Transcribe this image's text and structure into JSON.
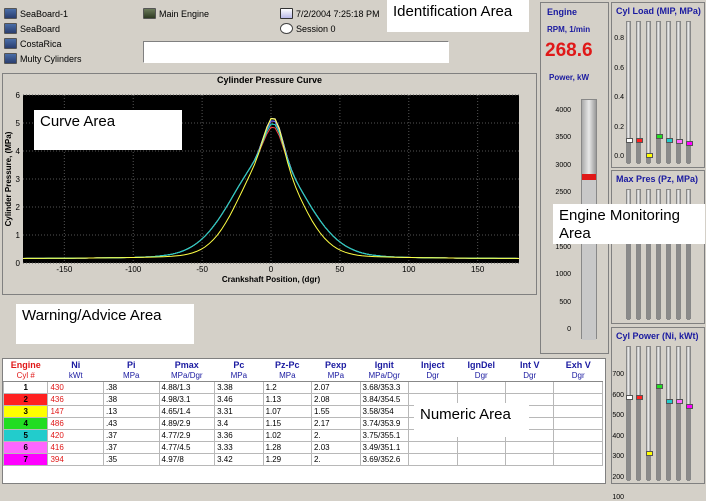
{
  "identification": {
    "left_items": [
      "SeaBoard-1",
      "SeaBoard",
      "CostaRica",
      "Multy Cylinders"
    ],
    "engine_label": "Main Engine",
    "datetime": "7/2/2004 7:25:18 PM",
    "session": "Session 0",
    "area_label": "Identification Area"
  },
  "curve": {
    "title": "Cylinder Pressure Curve",
    "area_label": "Curve Area",
    "chart_data": {
      "type": "line",
      "title": "Cylinder Pressure Curve",
      "xlabel": "Crankshaft Position, (dgr)",
      "ylabel": "Cylinder Pressure, (MPa)",
      "xlim": [
        -180,
        180
      ],
      "ylim": [
        0,
        6
      ],
      "x_ticks": [
        "-150",
        "-100",
        "-50",
        "0",
        "50",
        "100",
        "150"
      ],
      "y_ticks": [
        "0",
        "1",
        "2",
        "3",
        "4",
        "5",
        "6"
      ],
      "grid": true,
      "series_colors": [
        "#ff66ff",
        "#ffffff",
        "#ff4444",
        "#4466ff",
        "#44dd44",
        "#22cccc",
        "#ffff44"
      ]
    }
  },
  "warning": {
    "area_label": "Warning/Advice Area"
  },
  "engine": {
    "title": "Engine",
    "rpm_label": "RPM, 1/min",
    "rpm_value": "268.6",
    "power_label": "Power, kW",
    "scale": [
      "4000",
      "3500",
      "3000",
      "2500",
      "2000",
      "1500",
      "1000",
      "500",
      "0"
    ],
    "power_fraction": 0.68
  },
  "monitoring": {
    "area_label": "Engine Monitoring Area"
  },
  "cyl_load": {
    "title": "Cyl Load (MIP, MPa)",
    "ticks": [
      "0.8",
      "0.6",
      "0.4",
      "0.2",
      "0.0"
    ],
    "marker_colors": [
      "#ffffff",
      "#ff2020",
      "#ffff00",
      "#22dd22",
      "#22cccc",
      "#ff66ff",
      "#ff00ff"
    ]
  },
  "max_pres": {
    "title": "Max Pres (Pz, MPa)"
  },
  "cyl_power": {
    "title": "Cyl Power (Ni, kWt)",
    "ticks": [
      "700",
      "600",
      "500",
      "400",
      "300",
      "200",
      "100"
    ]
  },
  "numeric": {
    "area_label": "Numeric Area",
    "headers": [
      "Engine",
      "Ni",
      "Pi",
      "Pmax",
      "Pc",
      "Pz-Pc",
      "Pexp",
      "Ignit",
      "Inject",
      "IgnDel",
      "Int V",
      "Exh V"
    ],
    "units": [
      "Cyl #",
      "kWt",
      "MPa",
      "MPa/Dgr",
      "MPa",
      "MPa",
      "MPa",
      "MPa/Dgr",
      "Dgr",
      "Dgr",
      "Dgr",
      "Dgr"
    ],
    "rows": [
      {
        "cyl": "1",
        "color": "#ffffff",
        "ni": "430",
        "pi": ".38",
        "pmax": "4.88/1.3",
        "pc": "3.38",
        "pzpc": "1.2",
        "pexp": "2.07",
        "ignit": "3.68/353.3"
      },
      {
        "cyl": "2",
        "color": "#ff2020",
        "ni": "436",
        "pi": ".38",
        "pmax": "4.98/3.1",
        "pc": "3.46",
        "pzpc": "1.13",
        "pexp": "2.08",
        "ignit": "3.84/354.5"
      },
      {
        "cyl": "3",
        "color": "#ffff00",
        "ni": "147",
        "pi": ".13",
        "pmax": "4.65/1.4",
        "pc": "3.31",
        "pzpc": "1.07",
        "pexp": "1.55",
        "ignit": "3.58/354"
      },
      {
        "cyl": "4",
        "color": "#22dd22",
        "ni": "486",
        "pi": ".43",
        "pmax": "4.89/2.9",
        "pc": "3.4",
        "pzpc": "1.15",
        "pexp": "2.17",
        "ignit": "3.74/353.9"
      },
      {
        "cyl": "5",
        "color": "#22cccc",
        "ni": "420",
        "pi": ".37",
        "pmax": "4.77/2.9",
        "pc": "3.36",
        "pzpc": "1.02",
        "pexp": "2.",
        "ignit": "3.75/355.1"
      },
      {
        "cyl": "6",
        "color": "#ff66ff",
        "ni": "416",
        "pi": ".37",
        "pmax": "4.77/4.5",
        "pc": "3.33",
        "pzpc": "1.28",
        "pexp": "2.03",
        "ignit": "3.49/351.1"
      },
      {
        "cyl": "7",
        "color": "#ff00ff",
        "ni": "394",
        "pi": ".35",
        "pmax": "4.97/8",
        "pc": "3.42",
        "pzpc": "1.29",
        "pexp": "2.",
        "ignit": "3.69/352.6"
      }
    ]
  }
}
